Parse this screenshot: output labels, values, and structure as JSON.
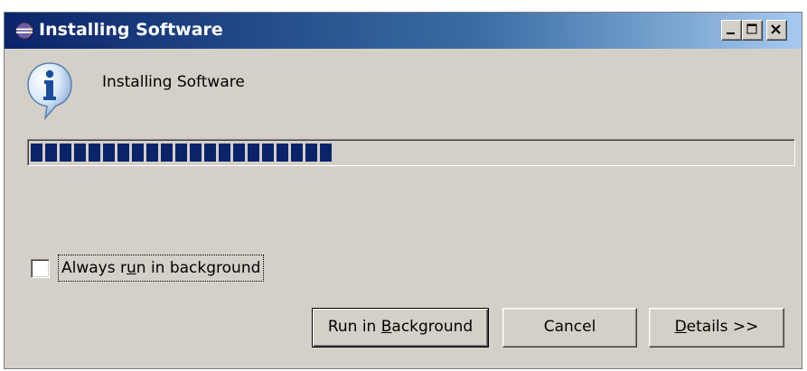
{
  "window": {
    "title": "Installing Software",
    "title_icon": "eclipse-icon",
    "controls": {
      "minimize": "minimize-icon",
      "maximize": "maximize-icon",
      "close": "close-icon"
    }
  },
  "dialog": {
    "icon": "info-icon",
    "message": "Installing Software",
    "progress_percent": 40
  },
  "options": {
    "always_background": {
      "label_pre": "Always r",
      "label_mnemonic": "u",
      "label_post": "n in background",
      "checked": false
    }
  },
  "buttons": {
    "run_background": {
      "label_pre": "Run in ",
      "label_mnemonic": "B",
      "label_post": "ackground"
    },
    "cancel": {
      "label": "Cancel"
    },
    "details": {
      "label_mnemonic": "D",
      "label_post": "etails >>"
    }
  },
  "colors": {
    "titlebar_start": "#0a246a",
    "titlebar_end": "#a6caf0",
    "progress_fill": "#0a246a",
    "window_bg": "#d4d0c8"
  }
}
